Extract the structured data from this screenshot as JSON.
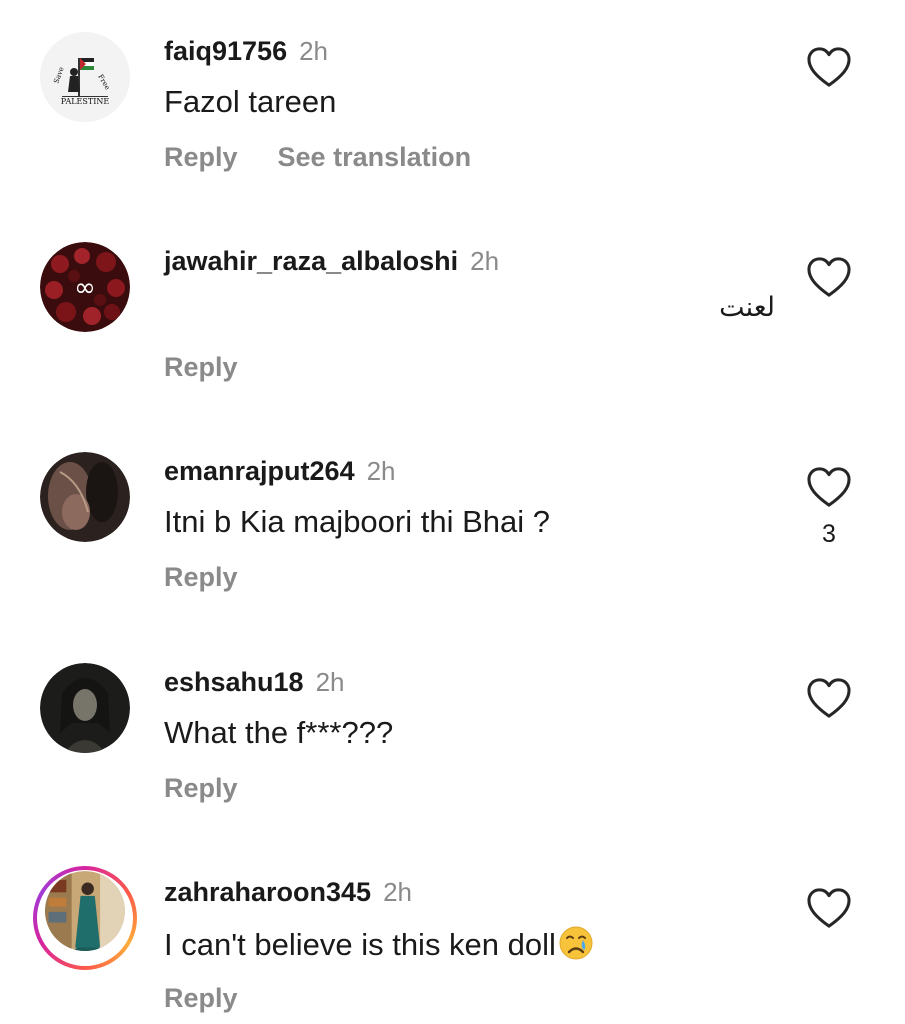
{
  "comments": [
    {
      "username": "faiq91756",
      "time": "2h",
      "text": "Fazol tareen",
      "reply_label": "Reply",
      "translate_label": "See translation",
      "avatar_text": "PALESTINE"
    },
    {
      "username": "jawahir_raza_albaloshi",
      "time": "2h",
      "text": "لعنت",
      "reply_label": "Reply",
      "avatar_text": "∞"
    },
    {
      "username": "emanrajput264",
      "time": "2h",
      "text": "Itni b Kia majboori thi Bhai ?",
      "reply_label": "Reply",
      "like_count": "3"
    },
    {
      "username": "eshsahu18",
      "time": "2h",
      "text": "What the f***???",
      "reply_label": "Reply"
    },
    {
      "username": "zahraharoon345",
      "time": "2h",
      "text": "I can't believe is this ken doll",
      "reply_label": "Reply",
      "emoji": "crying-face"
    }
  ],
  "colors": {
    "primary_text": "#1a1a1a",
    "secondary_text": "#8a8a8a",
    "background": "#ffffff",
    "story_ring": "#d6249f"
  },
  "icons": {
    "like": "heart-outline-icon"
  }
}
